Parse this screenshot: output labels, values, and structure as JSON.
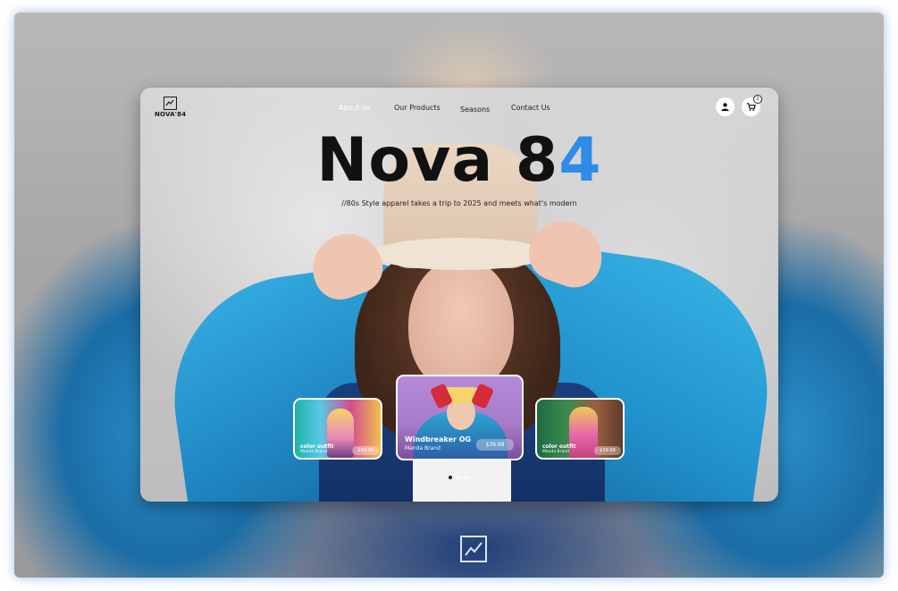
{
  "brand": {
    "logo_text": "NOVA'84",
    "hero_title_main": "Nova 8",
    "hero_title_accent": "4",
    "accent_color": "#2f8ce6",
    "tagline": "//80s Style apparel takes a trip to 2025 and meets what's modern"
  },
  "nav": {
    "items": [
      {
        "label": "About us",
        "active": true
      },
      {
        "label": "Our Products",
        "active": false
      },
      {
        "label": "Seasons",
        "active": false
      },
      {
        "label": "Contact Us",
        "active": false
      }
    ]
  },
  "header": {
    "account_icon": "user-icon",
    "cart_icon": "cart-icon",
    "cart_count": "2"
  },
  "products": [
    {
      "name": "color outfit",
      "brand": "Manda Brand",
      "price": "$39.99"
    },
    {
      "name": "Windbreaker OG",
      "brand": "Manda Brand",
      "price": "$39.99"
    },
    {
      "name": "color outfit",
      "brand": "Manda Brand",
      "price": "$39.99"
    }
  ],
  "carousel": {
    "total_slides": 3,
    "active_index": 0
  }
}
